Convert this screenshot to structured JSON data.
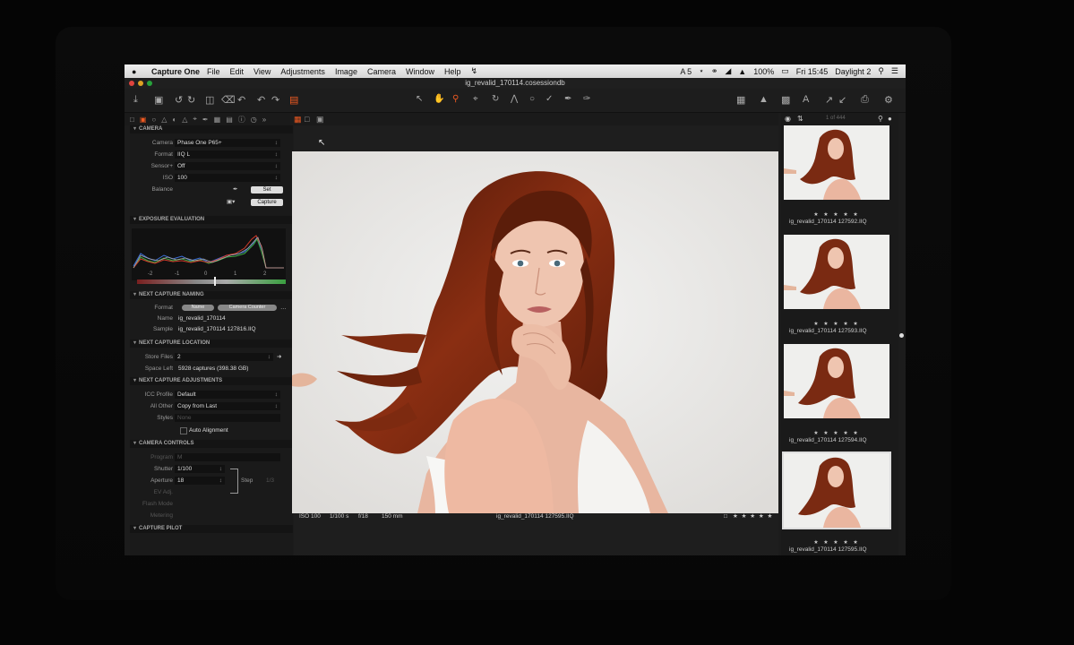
{
  "menubar": {
    "app_name": "Capture One",
    "items": [
      "File",
      "Edit",
      "View",
      "Adjustments",
      "Image",
      "Camera",
      "Window",
      "Help"
    ],
    "status": {
      "a_indicator": "A 5",
      "battery": "100%",
      "clock": "Fri 15:45",
      "user": "Daylight 2"
    }
  },
  "window": {
    "title": "ig_revalid_170114.cosessiondb"
  },
  "camera": {
    "header": "CAMERA",
    "camera_label": "Camera",
    "camera_value": "Phase One P65+",
    "format_label": "Format",
    "format_value": "IIQ L",
    "sensor_label": "Sensor+",
    "sensor_value": "Off",
    "iso_label": "ISO",
    "iso_value": "100",
    "balance_label": "Balance",
    "set_button": "Set",
    "capture_button": "Capture"
  },
  "exposure": {
    "header": "EXPOSURE EVALUATION",
    "scale": [
      "-2",
      "-1",
      "0",
      "1",
      "2"
    ]
  },
  "naming": {
    "header": "NEXT CAPTURE NAMING",
    "format_label": "Format",
    "format_tokens": [
      "Name",
      "Camera Counter"
    ],
    "name_label": "Name",
    "name_value": "ig_revalid_170114",
    "sample_label": "Sample",
    "sample_value": "ig_revalid_170114 127816.IIQ"
  },
  "location": {
    "header": "NEXT CAPTURE LOCATION",
    "store_label": "Store Files",
    "store_value": "2",
    "space_label": "Space Left",
    "space_value": "5928 captures (398.38 GB)"
  },
  "adjustments": {
    "header": "NEXT CAPTURE ADJUSTMENTS",
    "icc_label": "ICC Profile",
    "icc_value": "Default",
    "other_label": "All Other",
    "other_value": "Copy from Last",
    "styles_label": "Styles",
    "styles_value": "None",
    "auto_align": "Auto Alignment"
  },
  "controls": {
    "header": "CAMERA CONTROLS",
    "program_label": "Program",
    "program_value": "M",
    "shutter_label": "Shutter",
    "shutter_value": "1/100",
    "aperture_label": "Aperture",
    "aperture_value": "18",
    "ev_label": "EV Adj.",
    "flash_label": "Flash Mode",
    "metering_label": "Metering",
    "step_label": "Step",
    "step_value": "1/3"
  },
  "pilot": {
    "header": "CAPTURE PILOT"
  },
  "viewer": {
    "iso": "ISO 100",
    "shutter": "1/100 s",
    "aperture": "f/18",
    "focal": "150 mm",
    "filename": "ig_revalid_170114 127595.IIQ",
    "rating": "★ ★ ★ ★ ★"
  },
  "browser": {
    "counter": "1 of 444",
    "thumbs": [
      {
        "name": "ig_revalid_170114 127592.IIQ",
        "stars": "★ ★ ★ ★ ★"
      },
      {
        "name": "ig_revalid_170114 127593.IIQ",
        "stars": "★ ★ ★ ★ ★"
      },
      {
        "name": "ig_revalid_170114 127594.IIQ",
        "stars": "★ ★ ★ ★ ★"
      },
      {
        "name": "ig_revalid_170114 127595.IIQ",
        "stars": "★ ★ ★ ★ ★"
      }
    ]
  },
  "colors": {
    "accent": "#f05a22",
    "panel": "#1a1a1a",
    "backdrop": "#ededed",
    "hair": "#7a2a12"
  }
}
